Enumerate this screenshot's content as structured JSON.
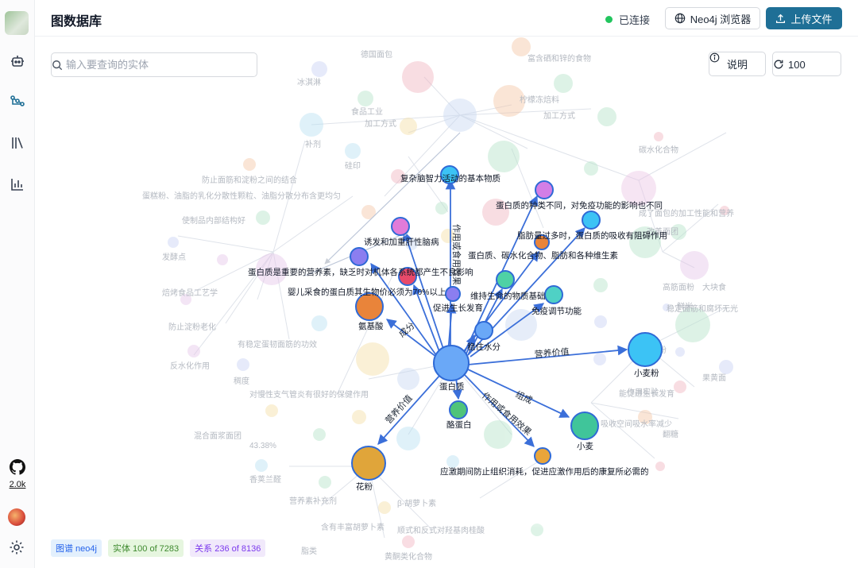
{
  "header": {
    "title": "图数据库",
    "status_text": "已连接",
    "neo4j_button": "Neo4j 浏览器",
    "upload_button": "上传文件"
  },
  "sidebar": {
    "github_stars": "2.0k",
    "items": [
      {
        "icon": "robot-icon"
      },
      {
        "icon": "graph-icon"
      },
      {
        "icon": "library-icon"
      },
      {
        "icon": "bar-chart-icon"
      }
    ]
  },
  "toolbar": {
    "search_placeholder": "输入要查询的实体",
    "info_button": "说明",
    "limit_value": "100"
  },
  "footer": {
    "graph_badge": "图谱 neo4j",
    "entity_badge": "实体 100 of 7283",
    "relation_badge": "关系 236 of 8136"
  },
  "colors": {
    "accent": "#1f6f96",
    "connected": "#22c55e",
    "edge": "#3b6fd9"
  },
  "graph": {
    "center": {
      "label": "蛋白质",
      "color": "#6aa8f7"
    },
    "nodes": [
      {
        "label": "复杂脑智力活动的基本物质",
        "color": "#3cc3f5"
      },
      {
        "label": "蛋白质的种类不同，对免疫功能的影响也不同",
        "color": "#d37ee6"
      },
      {
        "label": "",
        "color": "#3cc3f5"
      },
      {
        "label": "脂肪量过多时，蛋白质的吸收有阻碍作用",
        "color": "#e9843a"
      },
      {
        "label": "诱发和加重肝性脑病",
        "color": "#e07bd9"
      },
      {
        "label": "蛋白质是重要的营养素，缺乏时对机体各系统都产生不良影响",
        "color": "#8b7ef0"
      },
      {
        "label": "蛋白质、碳水化合物、脂肪和各种维生素",
        "color": "#e84a6a"
      },
      {
        "label": "婴儿采食的蛋白质其生物价必须为70%以上",
        "color": "#8b7ef0"
      },
      {
        "label": "促进生长发育",
        "color": ""
      },
      {
        "label": "维持生命的物质基础",
        "color": "#4fd1a5"
      },
      {
        "label": "免疫调节功能",
        "color": "#4fd1c5"
      },
      {
        "label": "氨基酸",
        "color": "#e9843a"
      },
      {
        "label": "稳住水分",
        "color": "#6aa8f7"
      },
      {
        "label": "小麦粉",
        "color": "#3cc3f5"
      },
      {
        "label": "酪蛋白",
        "color": "#4fc47a"
      },
      {
        "label": "小麦",
        "color": "#40c59a"
      },
      {
        "label": "应激期间防止组织消耗，促进应激作用后的康复所必需的",
        "color": "#e9a53a"
      },
      {
        "label": "花粉",
        "color": "#e0a53a"
      }
    ],
    "edges": [
      {
        "label": "作用或食用效果"
      },
      {
        "label": "成分"
      },
      {
        "label": "营养价值"
      },
      {
        "label": "组成"
      },
      {
        "label": "营养价值"
      },
      {
        "label": "作用或食用效果"
      }
    ]
  }
}
